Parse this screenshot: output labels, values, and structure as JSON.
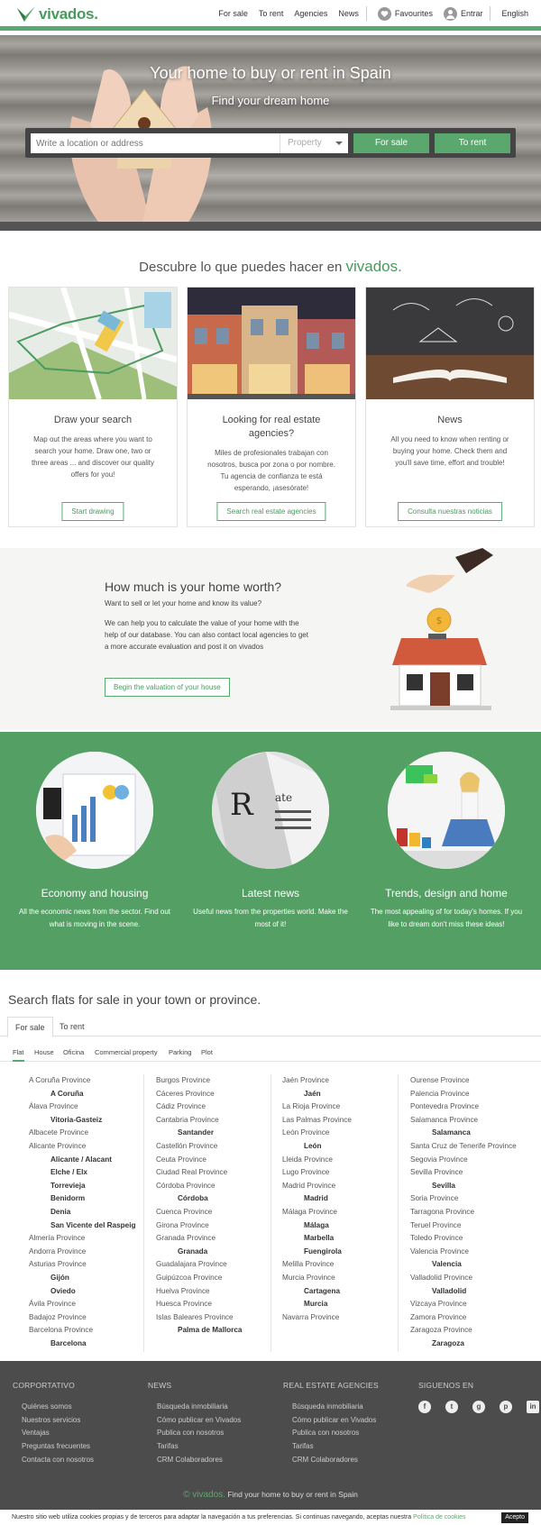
{
  "brand": {
    "name": "vivados.",
    "accent": "#5aa86e"
  },
  "nav": {
    "for_sale": "For sale",
    "to_rent": "To rent",
    "agencies": "Agencies",
    "news": "News",
    "favourites": "Favourites",
    "entrar": "Entrar",
    "language": "English"
  },
  "hero": {
    "title": "Your home to buy or rent in Spain",
    "subtitle": "Find your dream home",
    "search_placeholder": "Write a location or address",
    "property_select": "Property",
    "for_sale_btn": "For sale",
    "to_rent_btn": "To rent"
  },
  "discover": {
    "title": "Descubre lo que puedes hacer en",
    "brand": "vivados.",
    "cards": [
      {
        "title": "Draw your search",
        "text": "Map out the areas where you want to search your home. Draw one, two or three areas ... and discover our quality offers for you!",
        "button": "Start drawing"
      },
      {
        "title": "Looking for real estate agencies?",
        "text": "Miles de profesionales trabajan con nosotros, busca por zona o por nombre. Tu agencia de confianza te está esperando, ¡asesórate!",
        "button": "Search real estate agencies"
      },
      {
        "title": "News",
        "text": "All you need to know when renting or buying your home. Check them and you'll save time, effort and trouble!",
        "button": "Consulta nuestras noticias"
      }
    ]
  },
  "worth": {
    "title": "How much is your home worth?",
    "subtitle": "Want to sell or let your home and know its value?",
    "text": "We can help you to calculate the value of your home with the help of our database. You can also contact local agencies to get a more accurate evaluation and post it on vivados",
    "button": "Begin the valuation of your house"
  },
  "features": [
    {
      "title": "Economy and housing",
      "text": "All the economic news from the sector. Find out what is moving in the scene."
    },
    {
      "title": "Latest news",
      "text": "Useful news from the properties world. Make the most of it!"
    },
    {
      "title": "Trends, design and home",
      "text": "The most appealing of for today's homes. If you like to dream don't miss these ideas!"
    }
  ],
  "flats": {
    "title": "Search flats for sale in your town or province.",
    "tabs": [
      "For sale",
      "To rent"
    ],
    "subtabs": [
      "Flat",
      "House",
      "Oficina",
      "Commercial property",
      "Parking",
      "Plot"
    ],
    "columns": [
      [
        [
          "A Coruña Province",
          "c"
        ],
        [
          "A Coruña",
          "t"
        ],
        [
          "Álava Province",
          "c"
        ],
        [
          "Vitoria-Gasteiz",
          "t"
        ],
        [
          "Albacete Province",
          "c"
        ],
        [
          "Alicante Province",
          "c"
        ],
        [
          "Alicante / Alacant",
          "t"
        ],
        [
          "Elche / Elx",
          "t"
        ],
        [
          "Torrevieja",
          "t"
        ],
        [
          "Benidorm",
          "t"
        ],
        [
          "Denia",
          "t"
        ],
        [
          "San Vicente del Raspeig",
          "t"
        ],
        [
          "Almería Province",
          "c"
        ],
        [
          "Andorra Province",
          "c"
        ],
        [
          "Asturias Province",
          "c"
        ],
        [
          "Gijón",
          "t"
        ],
        [
          "Oviedo",
          "t"
        ],
        [
          "Ávila Province",
          "c"
        ],
        [
          "Badajoz Province",
          "c"
        ],
        [
          "Barcelona Province",
          "c"
        ],
        [
          "Barcelona",
          "t"
        ]
      ],
      [
        [
          "Burgos Province",
          "c"
        ],
        [
          "Cáceres Province",
          "c"
        ],
        [
          "Cádiz Province",
          "c"
        ],
        [
          "Cantabria Province",
          "c"
        ],
        [
          "Santander",
          "t"
        ],
        [
          "Castellón Province",
          "c"
        ],
        [
          "Ceuta Province",
          "c"
        ],
        [
          "Ciudad Real Province",
          "c"
        ],
        [
          "Córdoba Province",
          "c"
        ],
        [
          "Córdoba",
          "t"
        ],
        [
          "Cuenca Province",
          "c"
        ],
        [
          "Girona Province",
          "c"
        ],
        [
          "Granada Province",
          "c"
        ],
        [
          "Granada",
          "t"
        ],
        [
          "Guadalajara Province",
          "c"
        ],
        [
          "Guipúzcoa Province",
          "c"
        ],
        [
          "Huelva Province",
          "c"
        ],
        [
          "Huesca Province",
          "c"
        ],
        [
          "Islas Baleares Province",
          "c"
        ],
        [
          "Palma de Mallorca",
          "t"
        ]
      ],
      [
        [
          "Jaén Province",
          "c"
        ],
        [
          "Jaén",
          "t"
        ],
        [
          "La Rioja Province",
          "c"
        ],
        [
          "Las Palmas Province",
          "c"
        ],
        [
          "León Province",
          "c"
        ],
        [
          "León",
          "t"
        ],
        [
          "Lleida Province",
          "c"
        ],
        [
          "Lugo Province",
          "c"
        ],
        [
          "Madrid Province",
          "c"
        ],
        [
          "Madrid",
          "t"
        ],
        [
          "Málaga Province",
          "c"
        ],
        [
          "Málaga",
          "t"
        ],
        [
          "Marbella",
          "t"
        ],
        [
          "Fuengirola",
          "t"
        ],
        [
          "Melilla Province",
          "c"
        ],
        [
          "Murcia Province",
          "c"
        ],
        [
          "Cartagena",
          "t"
        ],
        [
          "Murcia",
          "t"
        ],
        [
          "Navarra Province",
          "c"
        ]
      ],
      [
        [
          "Ourense Province",
          "c"
        ],
        [
          "Palencia Province",
          "c"
        ],
        [
          "Pontevedra Province",
          "c"
        ],
        [
          "Salamanca Province",
          "c"
        ],
        [
          "Salamanca",
          "t"
        ],
        [
          "Santa Cruz de Tenerife Province",
          "c"
        ],
        [
          "Segovia Province",
          "c"
        ],
        [
          "Sevilla Province",
          "c"
        ],
        [
          "Sevilla",
          "t"
        ],
        [
          "Soria Province",
          "c"
        ],
        [
          "Tarragona Province",
          "c"
        ],
        [
          "Teruel Province",
          "c"
        ],
        [
          "Toledo Province",
          "c"
        ],
        [
          "Valencia Province",
          "c"
        ],
        [
          "Valencia",
          "t"
        ],
        [
          "Valladolid Province",
          "c"
        ],
        [
          "Valladolid",
          "t"
        ],
        [
          "Vizcaya Province",
          "c"
        ],
        [
          "Zamora Province",
          "c"
        ],
        [
          "Zaragoza Province",
          "c"
        ],
        [
          "Zaragoza",
          "t"
        ]
      ]
    ]
  },
  "footer": {
    "cols": [
      {
        "title": "CORPORTATIVO",
        "links": [
          "Quiénes somos",
          "Nuestros servicios",
          "Ventajas",
          "Preguntas frecuentes",
          "Contacta con nosotros"
        ]
      },
      {
        "title": "NEWS",
        "links": [
          "Búsqueda inmobiliaria",
          "Cómo publicar en Vivados",
          "Publica con nosotros",
          "Tarifas",
          "CRM Colaboradores"
        ]
      },
      {
        "title": "REAL ESTATE AGENCIES",
        "links": [
          "Búsqueda inmobiliaria",
          "Cómo publicar en Vivados",
          "Publica con nosotros",
          "Tarifas",
          "CRM Colaboradores"
        ]
      },
      {
        "title": "SIGUENOS EN",
        "links": []
      }
    ],
    "social": [
      "facebook-icon",
      "twitter-icon",
      "google-plus-icon",
      "pinterest-icon",
      "linkedin-icon"
    ],
    "tagline_brand": "© vivados.",
    "tagline": "Find your home to buy or rent in Spain"
  },
  "cookie": {
    "text": "Nuestro sitio web utiliza cookies propias y de terceros para adaptar la navegación a tus preferencias. Si continuas navegando, aceptas nuestra",
    "link": "Política de cookies",
    "accept": "Acepto"
  }
}
